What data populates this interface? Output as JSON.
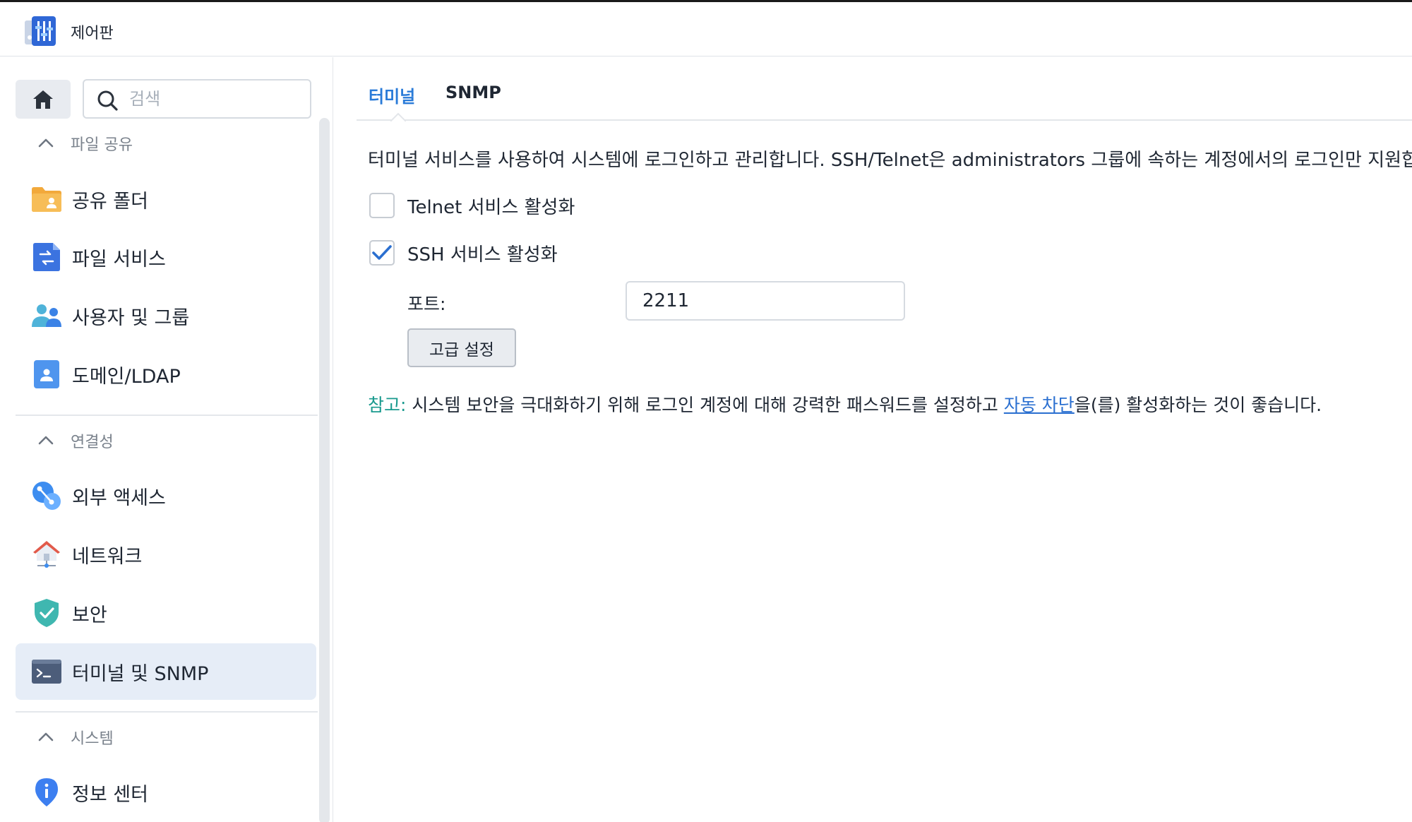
{
  "app": {
    "title": "제어판"
  },
  "search": {
    "placeholder": "검색"
  },
  "sidebar": {
    "sections": [
      {
        "title": "파일 공유"
      },
      {
        "title": "연결성"
      },
      {
        "title": "시스템"
      }
    ],
    "items": [
      {
        "label": "공유 폴더"
      },
      {
        "label": "파일 서비스"
      },
      {
        "label": "사용자 및 그룹"
      },
      {
        "label": "도메인/LDAP"
      },
      {
        "label": "외부 액세스"
      },
      {
        "label": "네트워크"
      },
      {
        "label": "보안"
      },
      {
        "label": "터미널 및 SNMP",
        "active": true
      },
      {
        "label": "정보 센터"
      }
    ]
  },
  "tabs": [
    {
      "label": "터미널",
      "active": true
    },
    {
      "label": "SNMP"
    }
  ],
  "terminal": {
    "description": "터미널 서비스를 사용하여 시스템에 로그인하고 관리합니다. SSH/Telnet은 administrators 그룹에 속하는 계정에서의 로그인만 지원합니다.",
    "telnet": {
      "label": "Telnet 서비스 활성화",
      "checked": false
    },
    "ssh": {
      "label": "SSH 서비스 활성화",
      "checked": true
    },
    "port_label": "포트:",
    "port_value": "2211",
    "advanced_button": "고급 설정",
    "note": {
      "prefix": "참고:",
      "text_before": " 시스템 보안을 극대화하기 위해 로그인 계정에 대해 강력한 패스워드를 설정하고 ",
      "link": "자동 차단",
      "text_after": "을(를) 활성화하는 것이 좋습니다."
    }
  },
  "colors": {
    "accent": "#2a7bd8",
    "active_item_bg": "#e6edf7",
    "note_prefix": "#1a9a8e",
    "link": "#2a6fd0"
  }
}
